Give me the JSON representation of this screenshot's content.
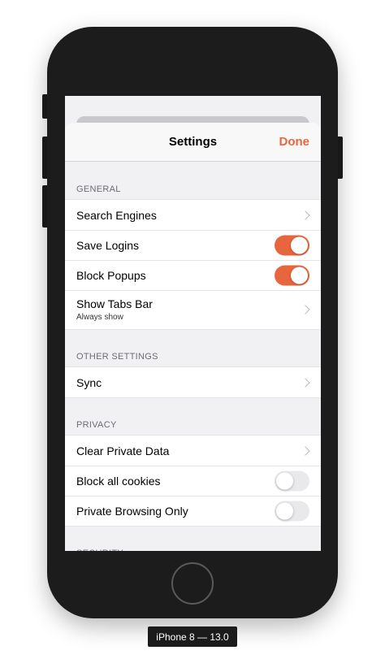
{
  "navbar": {
    "title": "Settings",
    "done_label": "Done"
  },
  "sections": [
    {
      "header": "GENERAL",
      "rows": [
        {
          "label": "Search Engines",
          "type": "chevron"
        },
        {
          "label": "Save Logins",
          "type": "toggle",
          "on": true
        },
        {
          "label": "Block Popups",
          "type": "toggle",
          "on": true
        },
        {
          "label": "Show Tabs Bar",
          "subtitle": "Always show",
          "type": "chevron"
        }
      ]
    },
    {
      "header": "OTHER SETTINGS",
      "rows": [
        {
          "label": "Sync",
          "type": "chevron"
        }
      ]
    },
    {
      "header": "PRIVACY",
      "rows": [
        {
          "label": "Clear Private Data",
          "type": "chevron"
        },
        {
          "label": "Block all cookies",
          "type": "toggle",
          "on": false
        },
        {
          "label": "Private Browsing Only",
          "type": "toggle",
          "on": false
        }
      ]
    },
    {
      "header": "SECURITY",
      "rows": []
    }
  ],
  "device_label": "iPhone 8 — 13.0",
  "colors": {
    "accent": "#e8663d",
    "toggle_off": "#e9e9eb",
    "background": "#f1f1f4"
  }
}
